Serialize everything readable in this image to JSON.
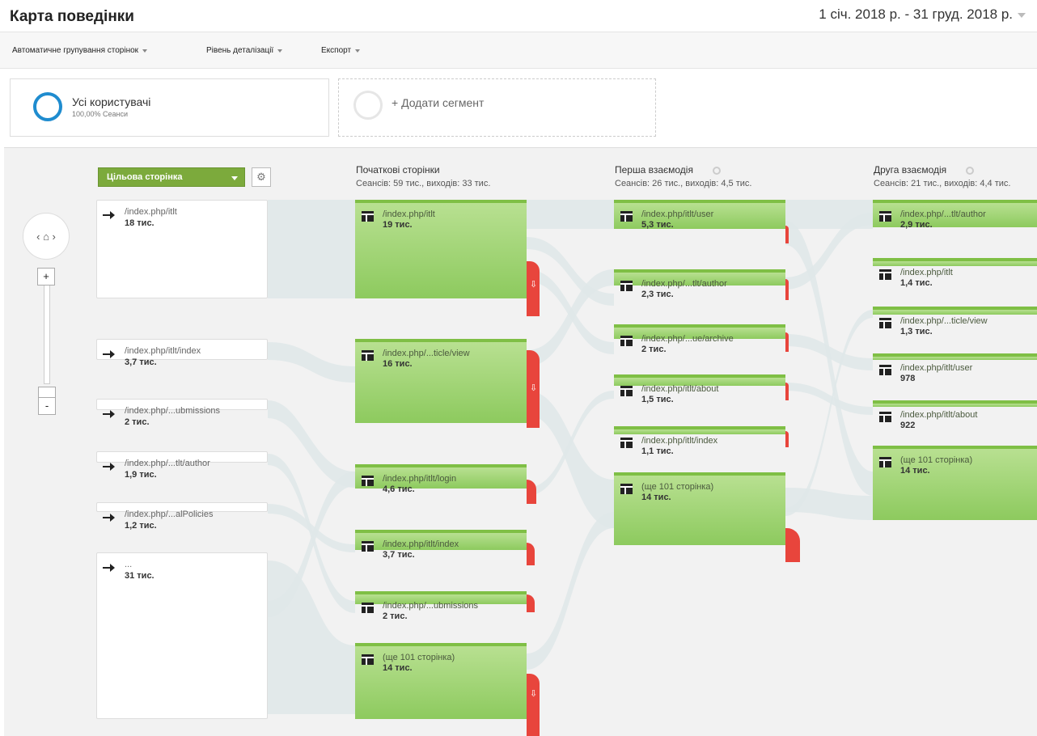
{
  "header": {
    "title": "Карта поведінки",
    "date_range": "1 січ. 2018 р. - 31 груд. 2018 р."
  },
  "toolbar": {
    "grouping": "Автоматичне групування сторінок",
    "detail": "Рівень деталізації",
    "export": "Експорт"
  },
  "segments": {
    "all_users": {
      "name": "Усі користувачі",
      "metric": "100,00% Сеанси",
      "color": "#1f8ccf"
    },
    "add": {
      "label": "+ Додати сегмент"
    }
  },
  "flow": {
    "dimension_dropdown": "Цільова сторінка",
    "columns": [
      {
        "title": "Початкові сторінки",
        "stats": "Сеансів: 59 тис., виходів: 33 тис."
      },
      {
        "title": "Перша взаємодія",
        "stats": "Сеансів: 26 тис., виходів: 4,5 тис."
      },
      {
        "title": "Друга взаємодія",
        "stats": "Сеансів: 21 тис., виходів: 4,4 тис."
      }
    ],
    "landing": [
      {
        "name": "/index.php/itlt",
        "value": "18 тис."
      },
      {
        "name": "/index.php/itlt/index",
        "value": "3,7 тис."
      },
      {
        "name": "/index.php/...ubmissions",
        "value": "2 тис."
      },
      {
        "name": "/index.php/...tlt/author",
        "value": "1,9 тис."
      },
      {
        "name": "/index.php/...alPolicies",
        "value": "1,2 тис."
      },
      {
        "name": "...",
        "value": "31 тис."
      }
    ],
    "start_pages": [
      {
        "name": "/index.php/itlt",
        "value": "19 тис."
      },
      {
        "name": "/index.php/...ticle/view",
        "value": "16 тис."
      },
      {
        "name": "/index.php/itlt/login",
        "value": "4,6 тис."
      },
      {
        "name": "/index.php/itlt/index",
        "value": "3,7 тис."
      },
      {
        "name": "/index.php/...ubmissions",
        "value": "2 тис."
      },
      {
        "name": "(ще 101 сторінка)",
        "value": "14 тис."
      }
    ],
    "first_interaction": [
      {
        "name": "/index.php/itlt/user",
        "value": "5,3 тис."
      },
      {
        "name": "/index.php/...tlt/author",
        "value": "2,3 тис."
      },
      {
        "name": "/index.php/...ue/archive",
        "value": "2 тис."
      },
      {
        "name": "/index.php/itlt/about",
        "value": "1,5 тис."
      },
      {
        "name": "/index.php/itlt/index",
        "value": "1,1 тис."
      },
      {
        "name": "(ще 101 сторінка)",
        "value": "14 тис."
      }
    ],
    "second_interaction": [
      {
        "name": "/index.php/...tlt/author",
        "value": "2,9 тис."
      },
      {
        "name": "/index.php/itlt",
        "value": "1,4 тис."
      },
      {
        "name": "/index.php/...ticle/view",
        "value": "1,3 тис."
      },
      {
        "name": "/index.php/itlt/user",
        "value": "978"
      },
      {
        "name": "/index.php/itlt/about",
        "value": "922"
      },
      {
        "name": "(ще 101 сторінка)",
        "value": "14 тис."
      }
    ]
  },
  "colors": {
    "node_green": "#8dca5e",
    "dropoff_red": "#e8453c",
    "dropdown_green": "#7caa3c"
  }
}
